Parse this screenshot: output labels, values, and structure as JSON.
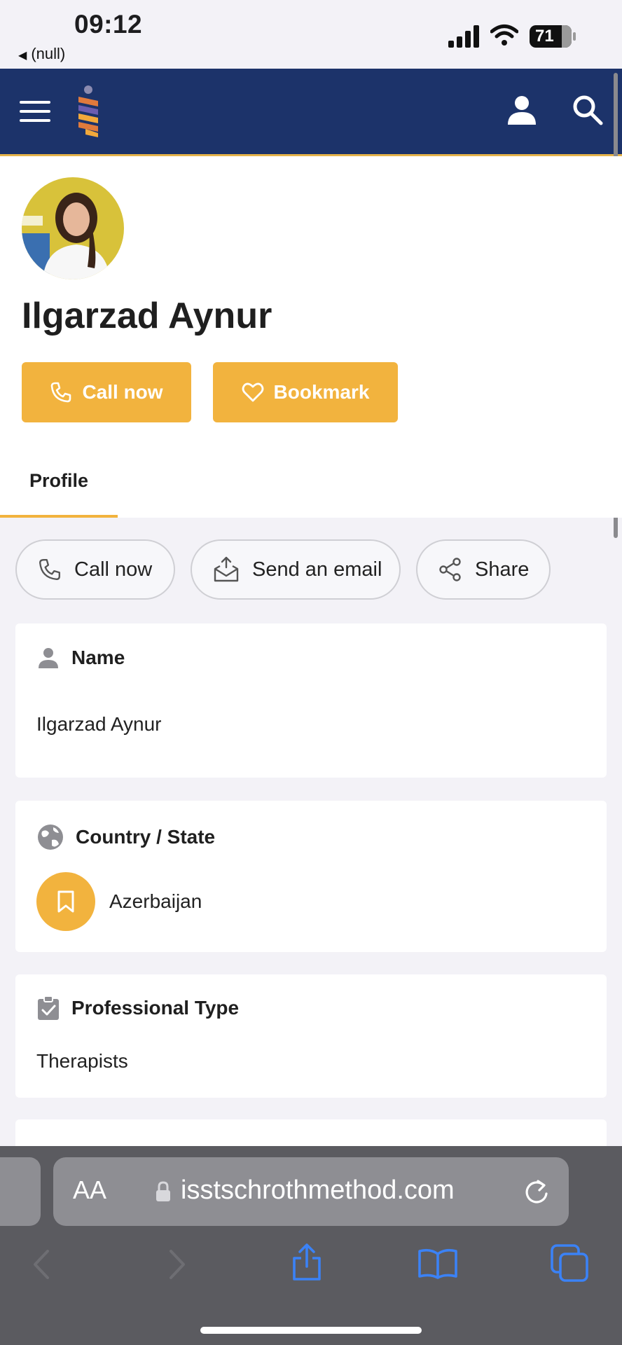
{
  "status_bar": {
    "time": "09:12",
    "back_app": "(null)",
    "battery": "71"
  },
  "header": {
    "icons": [
      "menu-icon",
      "logo",
      "user-icon",
      "search-icon"
    ]
  },
  "profile": {
    "name": "Ilgarzad Aynur",
    "call_button": "Call now",
    "bookmark_button": "Bookmark",
    "tab": "Profile"
  },
  "actions": {
    "call": "Call now",
    "email": "Send an email",
    "share": "Share"
  },
  "cards": {
    "name_label": "Name",
    "name_value": "Ilgarzad Aynur",
    "country_label": "Country / State",
    "country_value": "Azerbaijan",
    "type_label": "Professional Type",
    "type_value": "Therapists"
  },
  "safari": {
    "aa_label": "AA",
    "url": "isstschrothmethod.com"
  },
  "colors": {
    "header_bg": "#1c336a",
    "accent": "#f2b33e",
    "page_bg": "#f3f2f7"
  }
}
